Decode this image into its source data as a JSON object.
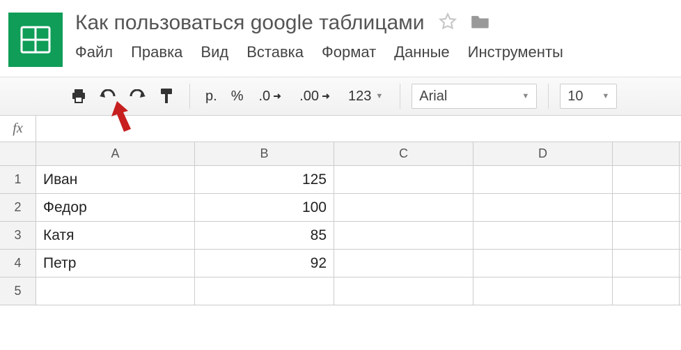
{
  "doc_title": "Как пользоваться google таблицами",
  "menu": {
    "file": "Файл",
    "edit": "Правка",
    "view": "Вид",
    "insert": "Вставка",
    "format": "Формат",
    "data": "Данные",
    "tools": "Инструменты"
  },
  "toolbar": {
    "currency": "р.",
    "percent": "%",
    "dec_decrease": ".0",
    "dec_increase": ".00",
    "more_formats": "123",
    "font": "Arial",
    "font_size": "10"
  },
  "formula_label": "fx",
  "columns": [
    "A",
    "B",
    "C",
    "D"
  ],
  "rows": [
    "1",
    "2",
    "3",
    "4",
    "5"
  ],
  "cells": {
    "A1": "Иван",
    "B1": "125",
    "A2": "Федор",
    "B2": "100",
    "A3": "Катя",
    "B3": "85",
    "A4": "Петр",
    "B4": "92"
  },
  "chart_data": {
    "type": "table",
    "columns": [
      "A",
      "B"
    ],
    "rows": [
      {
        "A": "Иван",
        "B": 125
      },
      {
        "A": "Федор",
        "B": 100
      },
      {
        "A": "Катя",
        "B": 85
      },
      {
        "A": "Петр",
        "B": 92
      }
    ]
  }
}
